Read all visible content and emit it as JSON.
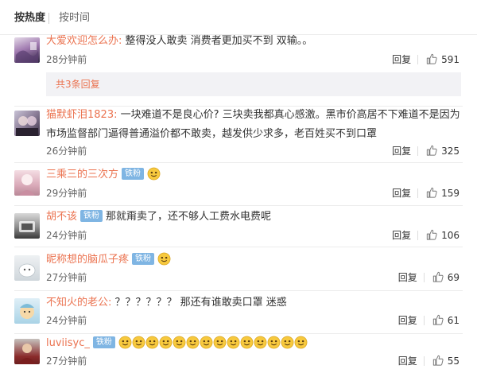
{
  "sort": {
    "hot_label": "按热度",
    "time_label": "按时间"
  },
  "reply_label": "回复",
  "comments": [
    {
      "user": "大爱欢迎怎么办:",
      "text": " 整得没人敢卖 消费者更加买不到 双输。。",
      "time": "28分钟前",
      "likes": "591",
      "subreplies": "共3条回复"
    },
    {
      "user": "猫默虾泪1823:",
      "text": " 一块难道不是良心价? 三块卖我都真心感激。黑市价高居不下难道不是因为市场监督部门逼得普通溢价都不敢卖，越发供少求多，老百姓买不到口罩",
      "time": "26分钟前",
      "likes": "325"
    },
    {
      "user": "三乘三的三次方",
      "badge": "铁粉",
      "text": "",
      "time": "29分钟前",
      "likes": "159"
    },
    {
      "user": "胡不该",
      "badge": "铁粉",
      "text": "那就甭卖了，还不够人工费水电费呢",
      "time": "24分钟前",
      "likes": "106"
    },
    {
      "user": "昵称想的脑瓜子疼",
      "badge": "铁粉",
      "text": "",
      "time": "27分钟前",
      "likes": "69"
    },
    {
      "user": "不知火的老公:",
      "text": " ？？？？？？ 那还有谁敢卖口罩 迷惑",
      "time": "24分钟前",
      "likes": "61"
    },
    {
      "user": "luviisyc_",
      "badge": "铁粉",
      "text": "",
      "time": "27分钟前",
      "likes": "55"
    }
  ],
  "icons": {
    "like": "thumbs-up-icon",
    "emoji": "smiley-face-icon"
  },
  "colors": {
    "username": "#eb7350",
    "badge": "#7fb5e3",
    "sub_bg": "#f2f2f5"
  }
}
